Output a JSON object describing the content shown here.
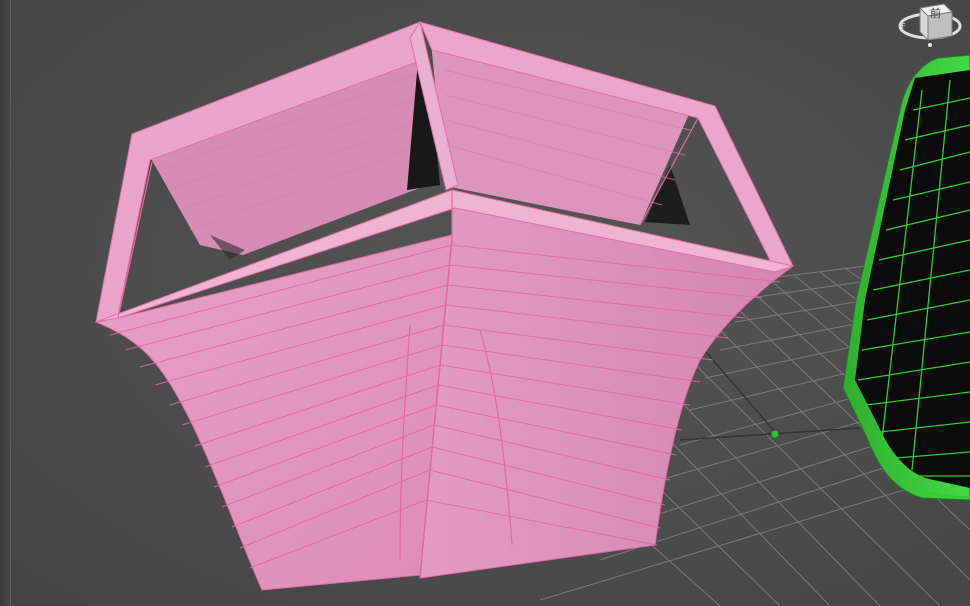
{
  "viewport": {
    "viewcube_face_label": "前",
    "viewcube_compass_letter": "F"
  },
  "objects": [
    {
      "name": "pink-vase",
      "color": "#e79bc3",
      "wire_color": "#e05a9a"
    },
    {
      "name": "green-box",
      "color": "#3fd141",
      "wire_color": "#000000"
    }
  ],
  "colors": {
    "background": "#4f4f4f",
    "grid": "#8a8a8a",
    "pivot": "#22cc22"
  }
}
